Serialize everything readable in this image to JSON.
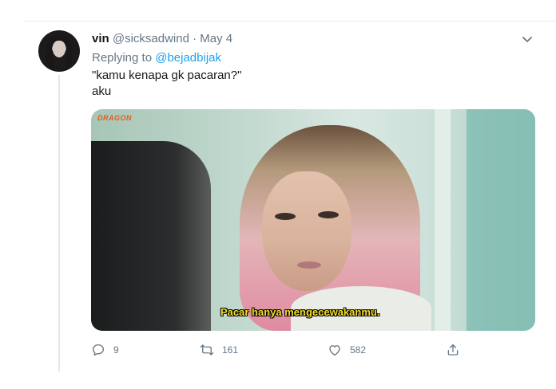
{
  "tweet": {
    "display_name": "vin",
    "handle": "@sicksadwind",
    "separator": "·",
    "date": "May 4",
    "replying_label": "Replying to",
    "replying_handle": "@bejadbijak",
    "text_line1": "\"kamu kenapa gk pacaran?\"",
    "text_line2": "aku"
  },
  "media": {
    "watermark": "DRAGON",
    "subtitle": "Pacar hanya mengecewakanmu."
  },
  "actions": {
    "reply_count": "9",
    "retweet_count": "161",
    "like_count": "582"
  },
  "icons": [
    "avatar",
    "chevron-down-icon",
    "reply-icon",
    "retweet-icon",
    "like-icon",
    "share-icon"
  ],
  "colors": {
    "accent": "#1da1f2",
    "secondary_text": "#657786",
    "subtitle_yellow": "#f3df2a"
  }
}
